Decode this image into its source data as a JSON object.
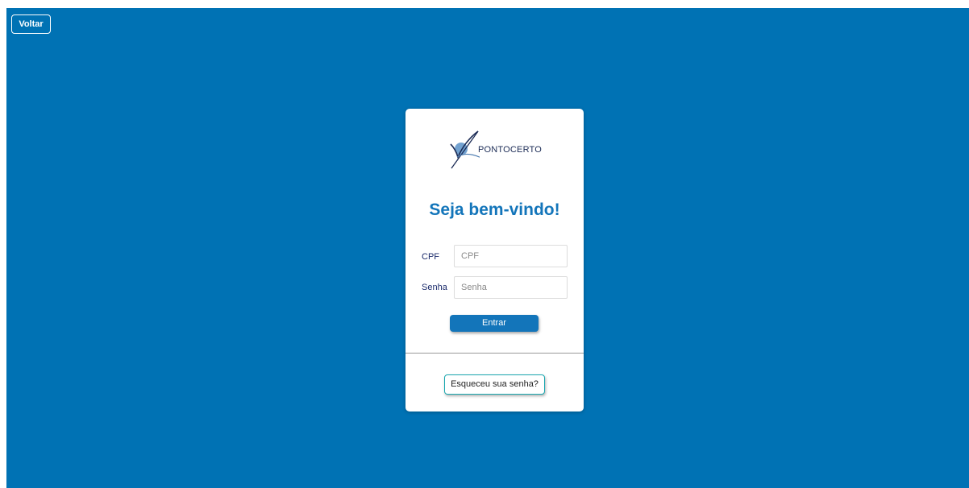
{
  "header": {
    "back_label": "Voltar"
  },
  "login": {
    "logo_text": "PONTOCERTO",
    "welcome_title": "Seja bem-vindo!",
    "cpf_label": "CPF",
    "cpf_placeholder": "CPF",
    "cpf_value": "",
    "password_label": "Senha",
    "password_placeholder": "Senha",
    "password_value": "",
    "submit_label": "Entrar",
    "forgot_label": "Esqueceu sua senha?"
  },
  "icons": {
    "logo": "pontocerto-check-logo-icon"
  },
  "colors": {
    "background": "#0072b4",
    "card": "#ffffff",
    "primary": "#1375ba",
    "label": "#1b2b6b",
    "forgot_border": "#1aa8b0"
  }
}
